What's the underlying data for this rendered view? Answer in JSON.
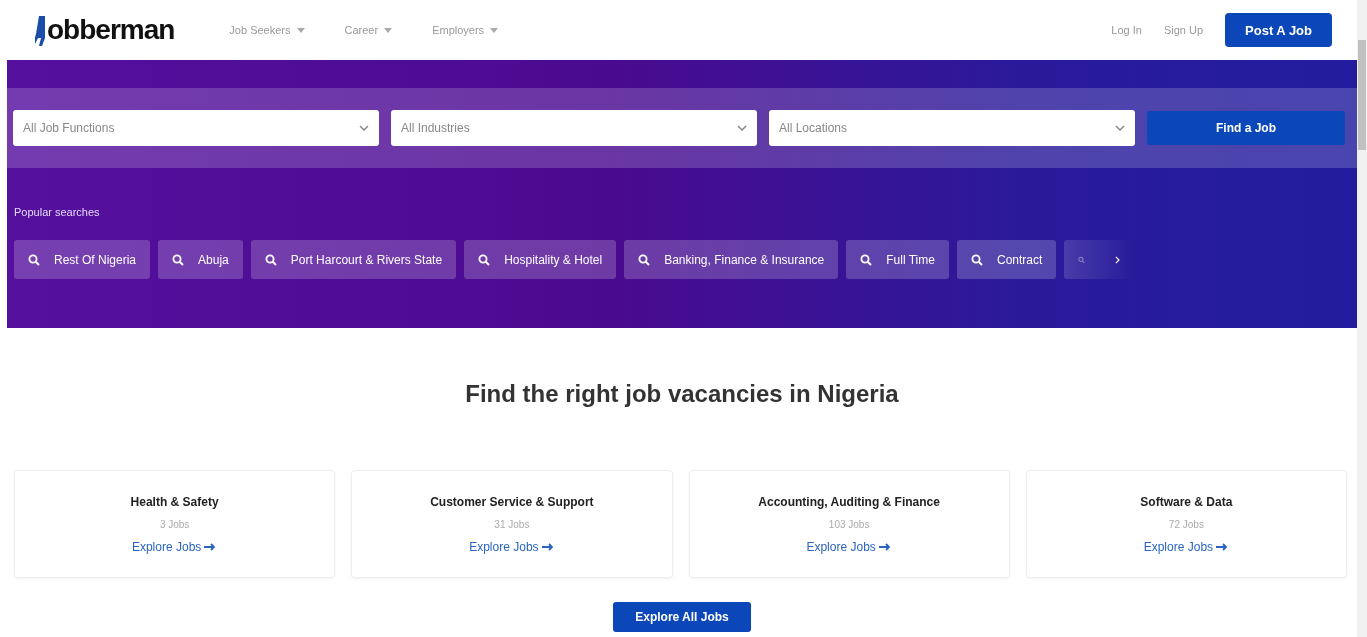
{
  "header": {
    "logo": "obberman",
    "nav": [
      {
        "label": "Job Seekers"
      },
      {
        "label": "Career"
      },
      {
        "label": "Employers"
      }
    ],
    "login": "Log In",
    "signup": "Sign Up",
    "post_job": "Post A Job"
  },
  "search": {
    "selects": [
      {
        "placeholder": "All Job Functions"
      },
      {
        "placeholder": "All Industries"
      },
      {
        "placeholder": "All Locations"
      }
    ],
    "button": "Find a Job"
  },
  "popular": {
    "title": "Popular searches",
    "chips": [
      "Rest Of Nigeria",
      "Abuja",
      "Port Harcourt & Rivers State",
      "Hospitality & Hotel",
      "Banking, Finance & Insurance",
      "Full Time",
      "Contract"
    ]
  },
  "heading": "Find the right job vacancies in Nigeria",
  "categories": [
    {
      "title": "Health & Safety",
      "count": "3 Jobs",
      "link": "Explore Jobs"
    },
    {
      "title": "Customer Service & Support",
      "count": "31 Jobs",
      "link": "Explore Jobs"
    },
    {
      "title": "Accounting, Auditing & Finance",
      "count": "103 Jobs",
      "link": "Explore Jobs"
    },
    {
      "title": "Software & Data",
      "count": "72 Jobs",
      "link": "Explore Jobs"
    }
  ],
  "explore_all": "Explore All Jobs"
}
